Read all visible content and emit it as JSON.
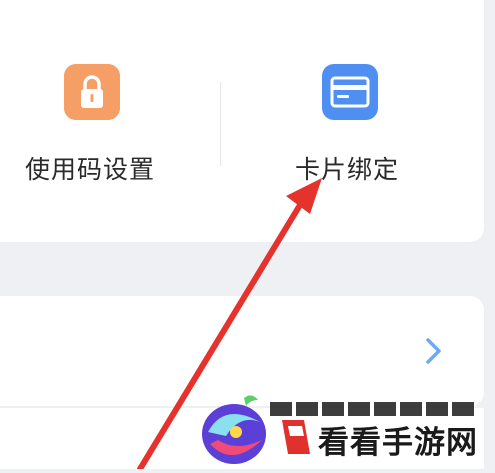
{
  "settings": {
    "items": [
      {
        "label": "使用码设置",
        "icon": "lock-icon",
        "color": "#f59e66"
      },
      {
        "label": "卡片绑定",
        "icon": "card-icon",
        "color": "#4f8ff2"
      }
    ]
  },
  "annotation": {
    "arrow_color": "#e5322d"
  },
  "watermark": {
    "text": "看看手游网"
  }
}
